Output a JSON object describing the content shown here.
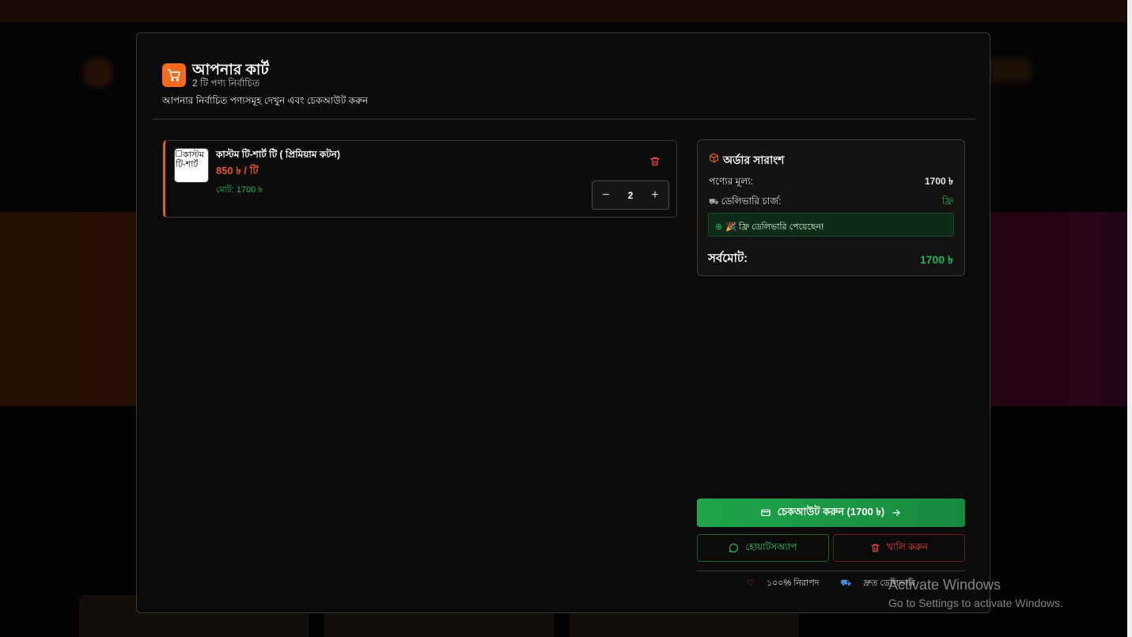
{
  "modal": {
    "title": "আপনার কার্ট",
    "subtitle": "2 টি পণ্য নির্বাচিত",
    "description": "আপনার নির্বাচিত পণ্যসমূহ দেখুন এবং চেকআউট করুন",
    "accent_color": "#f26b1d"
  },
  "cart": {
    "items": [
      {
        "image_alt": "কাস্টম টি-শার্ট",
        "name": "কাস্টম টি-শার্ট টি ( প্রিমিয়াম কটন)",
        "price": "850 ৳ / টি",
        "total": "মোট: 1700 ৳",
        "quantity": "2",
        "decrease_symbol": "−",
        "increase_symbol": "+"
      }
    ]
  },
  "summary": {
    "title": "অর্ডার সারাংশ",
    "subtotal_label": "পণ্যের মূল্য:",
    "subtotal_value": "1700 ৳",
    "delivery_label": "ডেলিভারি চার্জ:",
    "delivery_value": "ফ্রি",
    "free_message": "🎉 ফ্রি ডেলিভারি পেয়েছেন!",
    "grand_total_label": "সর্বমোট:",
    "grand_total_value": "1700 ৳"
  },
  "actions": {
    "checkout_label": "চেকআউট করুন (1700 ৳)",
    "whatsapp_label": "হোয়াটসঅ্যাপ",
    "clear_label": "খালি করুন",
    "checkout_color": "#1fa54a",
    "whatsapp_color": "#2fcf65",
    "clear_color": "#ef4444"
  },
  "footer": {
    "secure_label": "১০০% নিরাপদ",
    "fast_delivery_label": "দ্রুত ডেলিভারি"
  },
  "watermark": {
    "line1": "Activate Windows",
    "line2": "Go to Settings to activate Windows."
  },
  "icons": {
    "header": "cart-icon",
    "summary": "package-icon",
    "delete": "trash-icon",
    "checkout": "card-icon",
    "whatsapp": "chat-icon",
    "arrow": "arrow-right-icon"
  }
}
